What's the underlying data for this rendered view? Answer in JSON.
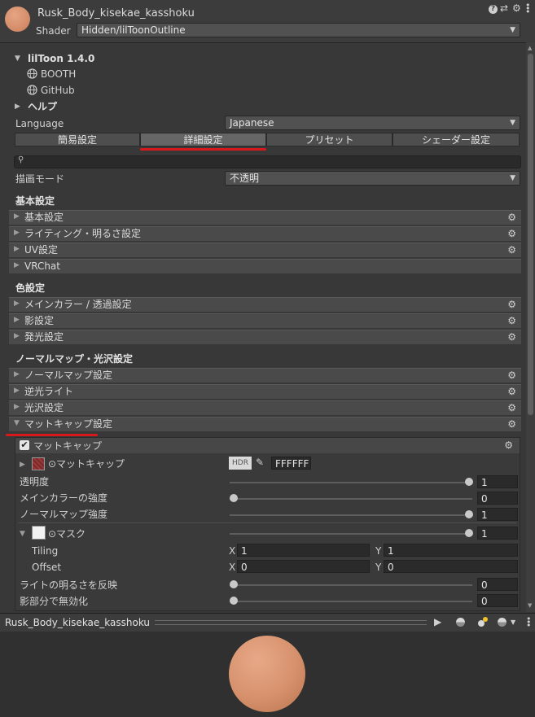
{
  "header": {
    "title": "Rusk_Body_kisekae_kasshoku",
    "shader_label": "Shader",
    "shader_value": "Hidden/lilToonOutline",
    "help_glyph": "?",
    "preset_glyph": "⇄",
    "gear_glyph": "⚙"
  },
  "liltoon": {
    "version": "lilToon 1.4.0",
    "booth": "BOOTH",
    "github": "GitHub",
    "help": "ヘルプ"
  },
  "language": {
    "label": "Language",
    "value": "Japanese"
  },
  "tabs": [
    {
      "label": "簡易設定",
      "active": false
    },
    {
      "label": "詳細設定",
      "active": true
    },
    {
      "label": "プリセット",
      "active": false
    },
    {
      "label": "シェーダー設定",
      "active": false
    }
  ],
  "search": {
    "icon": "⚲",
    "value": ""
  },
  "render_mode": {
    "label": "描画モード",
    "value": "不透明"
  },
  "sections": {
    "basic": {
      "heading": "基本設定",
      "items": [
        "基本設定",
        "ライティング・明るさ設定",
        "UV設定",
        "VRChat"
      ]
    },
    "color": {
      "heading": "色設定",
      "items": [
        "メインカラー / 透過設定",
        "影設定",
        "発光設定"
      ]
    },
    "normal": {
      "heading": "ノーマルマップ・光沢設定",
      "items": [
        "ノーマルマップ設定",
        "逆光ライト",
        "光沢設定",
        "マットキャップ設定"
      ]
    }
  },
  "matcap": {
    "toggle_label": "マットキャップ",
    "enabled": true,
    "texture_label": "⊙マットキャップ",
    "hdr_label": "HDR",
    "color_hex": "FFFFFF",
    "props": [
      {
        "label": "透明度",
        "value": "1",
        "fraction": 1.0
      },
      {
        "label": "メインカラーの強度",
        "value": "0",
        "fraction": 0.0
      },
      {
        "label": "ノーマルマップ強度",
        "value": "1",
        "fraction": 1.0
      }
    ],
    "mask": {
      "label": "⊙マスク",
      "value": "1",
      "fraction": 1.0,
      "tiling_label": "Tiling",
      "tiling_x": "1",
      "tiling_y": "1",
      "offset_label": "Offset",
      "offset_x": "0",
      "offset_y": "0",
      "x_label": "X",
      "y_label": "Y"
    },
    "props2": [
      {
        "label": "ライトの明るさを反映",
        "value": "0",
        "fraction": 0.0
      },
      {
        "label": "影部分で無効化",
        "value": "0",
        "fraction": 0.0
      }
    ]
  },
  "preview": {
    "title": "Rusk_Body_kisekae_kasshoku",
    "sphere_color": "#d6916c"
  },
  "colors": {
    "accent_red": "#d7191b",
    "panel": "#383838",
    "foldout": "#4a4a4a"
  }
}
